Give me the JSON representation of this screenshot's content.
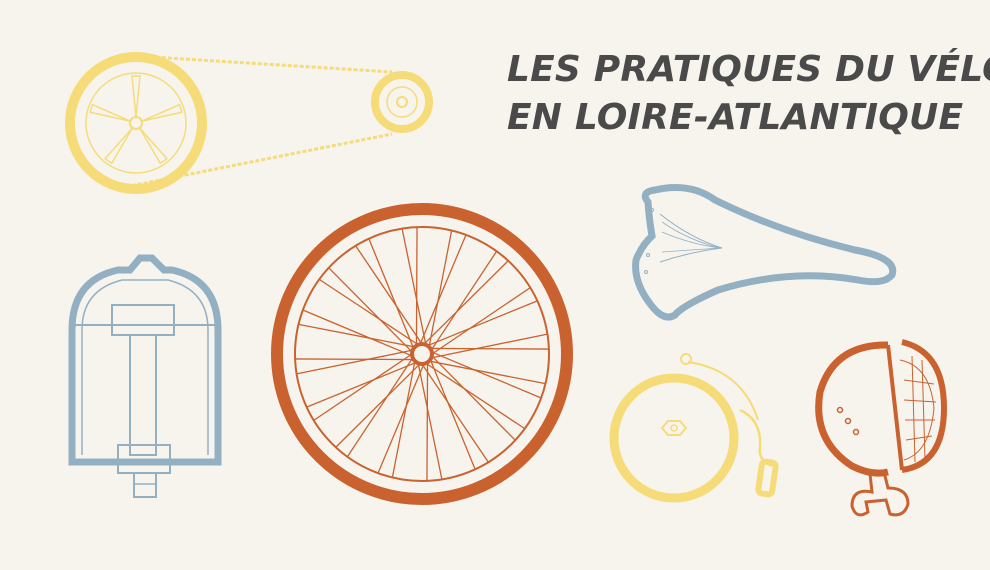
{
  "title": {
    "line1": "LES PRATIQUES DU VÉLO",
    "line2": "EN LOIRE-ATLANTIQUE"
  },
  "colors": {
    "background": "#f7f4ee",
    "title": "#4a4a4a",
    "yellow": "#f5dc78",
    "orange": "#c9622f",
    "blue": "#93b0c3"
  },
  "illustrations": [
    "chainring-and-chain-icon",
    "bicycle-pedal-icon",
    "bicycle-wheel-icon",
    "bicycle-saddle-icon",
    "bicycle-bell-icon",
    "bicycle-headlight-icon"
  ]
}
